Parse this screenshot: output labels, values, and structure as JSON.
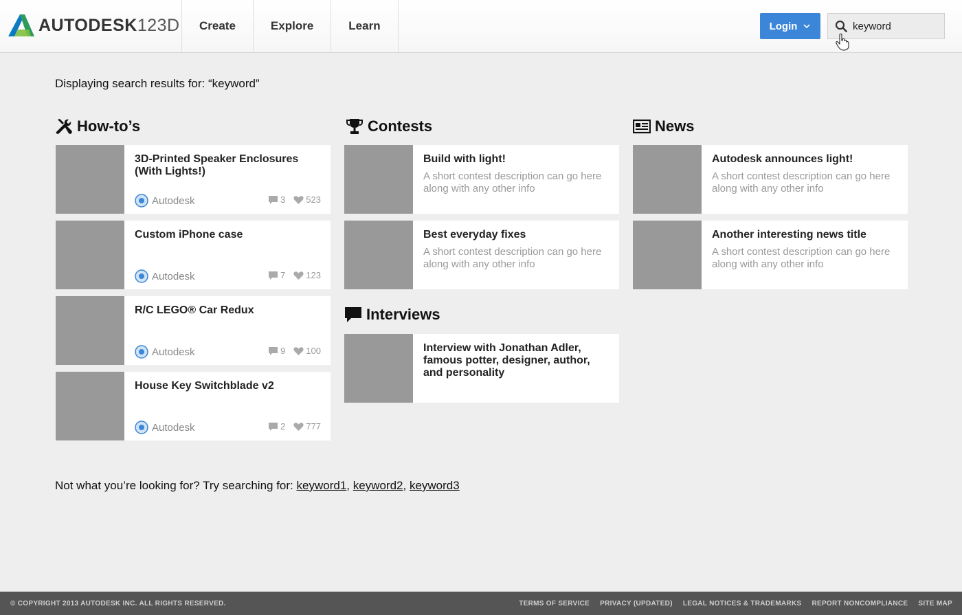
{
  "header": {
    "logo_brand": "AUTODESK",
    "logo_product": "123D",
    "nav": [
      "Create",
      "Explore",
      "Learn"
    ],
    "login_label": "Login",
    "search_value": "keyword"
  },
  "results_heading": "Displaying search results for: “keyword”",
  "howtos": {
    "title": "How-to’s",
    "items": [
      {
        "title": "3D-Printed Speaker Enclosures (With Lights!)",
        "author": "Autodesk",
        "comments": "3",
        "likes": "523"
      },
      {
        "title": "Custom iPhone case",
        "author": "Autodesk",
        "comments": "7",
        "likes": "123"
      },
      {
        "title": "R/C LEGO® Car Redux",
        "author": "Autodesk",
        "comments": "9",
        "likes": "100"
      },
      {
        "title": "House Key Switchblade v2",
        "author": "Autodesk",
        "comments": "2",
        "likes": "777"
      }
    ]
  },
  "contests": {
    "title": "Contests",
    "items": [
      {
        "title": "Build with light!",
        "desc": "A short contest description can go here along with any other info"
      },
      {
        "title": "Best everyday fixes",
        "desc": "A short contest description can go here along with any other info"
      }
    ]
  },
  "interviews": {
    "title": "Interviews",
    "items": [
      {
        "title": "Interview with Jonathan Adler, famous potter, designer, author, and personality"
      }
    ]
  },
  "news": {
    "title": "News",
    "items": [
      {
        "title": "Autodesk announces light!",
        "desc": "A short contest description can go here along with any other info"
      },
      {
        "title": "Another interesting news title",
        "desc": "A short contest description can go here along with any other info"
      }
    ]
  },
  "suggest": {
    "prefix": "Not what you’re looking for? Try searching for:",
    "keywords": [
      "keyword1",
      "keyword2",
      "keyword3"
    ]
  },
  "footer": {
    "copyright": "© COPYRIGHT 2013 AUTODESK INC. ALL RIGHTS RESERVED.",
    "links": [
      "TERMS OF SERVICE",
      "PRIVACY (UPDATED)",
      "LEGAL NOTICES & TRADEMARKS",
      "REPORT NONCOMPLIANCE",
      "SITE MAP"
    ]
  },
  "colors": {
    "accent": "#3b86d8",
    "thumb": "#999999",
    "footer_bg": "#555555"
  }
}
